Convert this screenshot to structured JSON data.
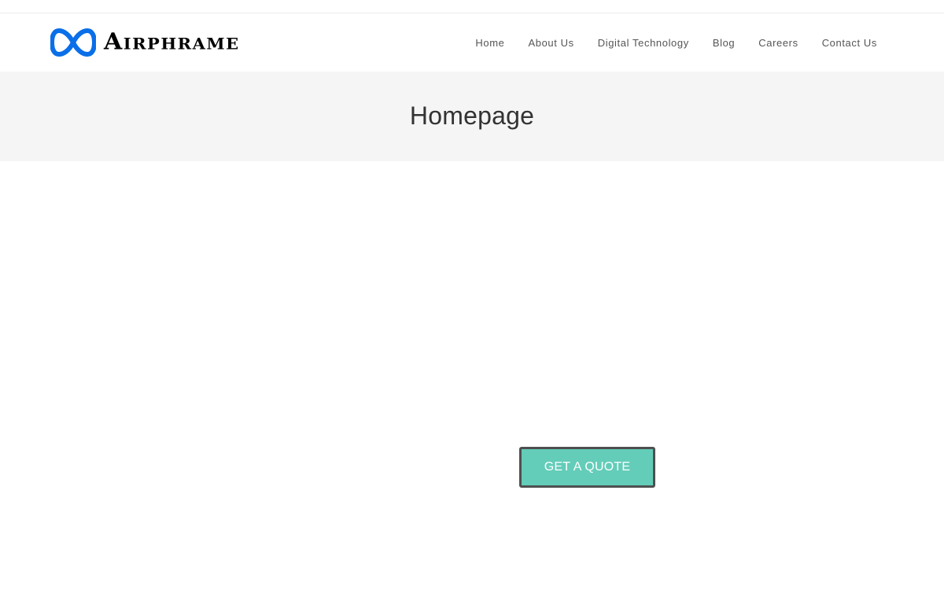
{
  "brand": {
    "name": "Airphrame",
    "logo_icon": "infinity-logo-icon",
    "logo_color": "#0a6fe8"
  },
  "nav": {
    "items": [
      {
        "label": "Home"
      },
      {
        "label": "About Us"
      },
      {
        "label": "Digital Technology"
      },
      {
        "label": "Blog"
      },
      {
        "label": "Careers"
      },
      {
        "label": "Contact Us"
      }
    ]
  },
  "page_header": {
    "title": "Homepage"
  },
  "content": {
    "cta_label": "GET A QUOTE"
  },
  "colors": {
    "cta_background": "#63cdb9",
    "cta_border": "#4f4f4f",
    "page_header_background": "#f5f5f5"
  }
}
